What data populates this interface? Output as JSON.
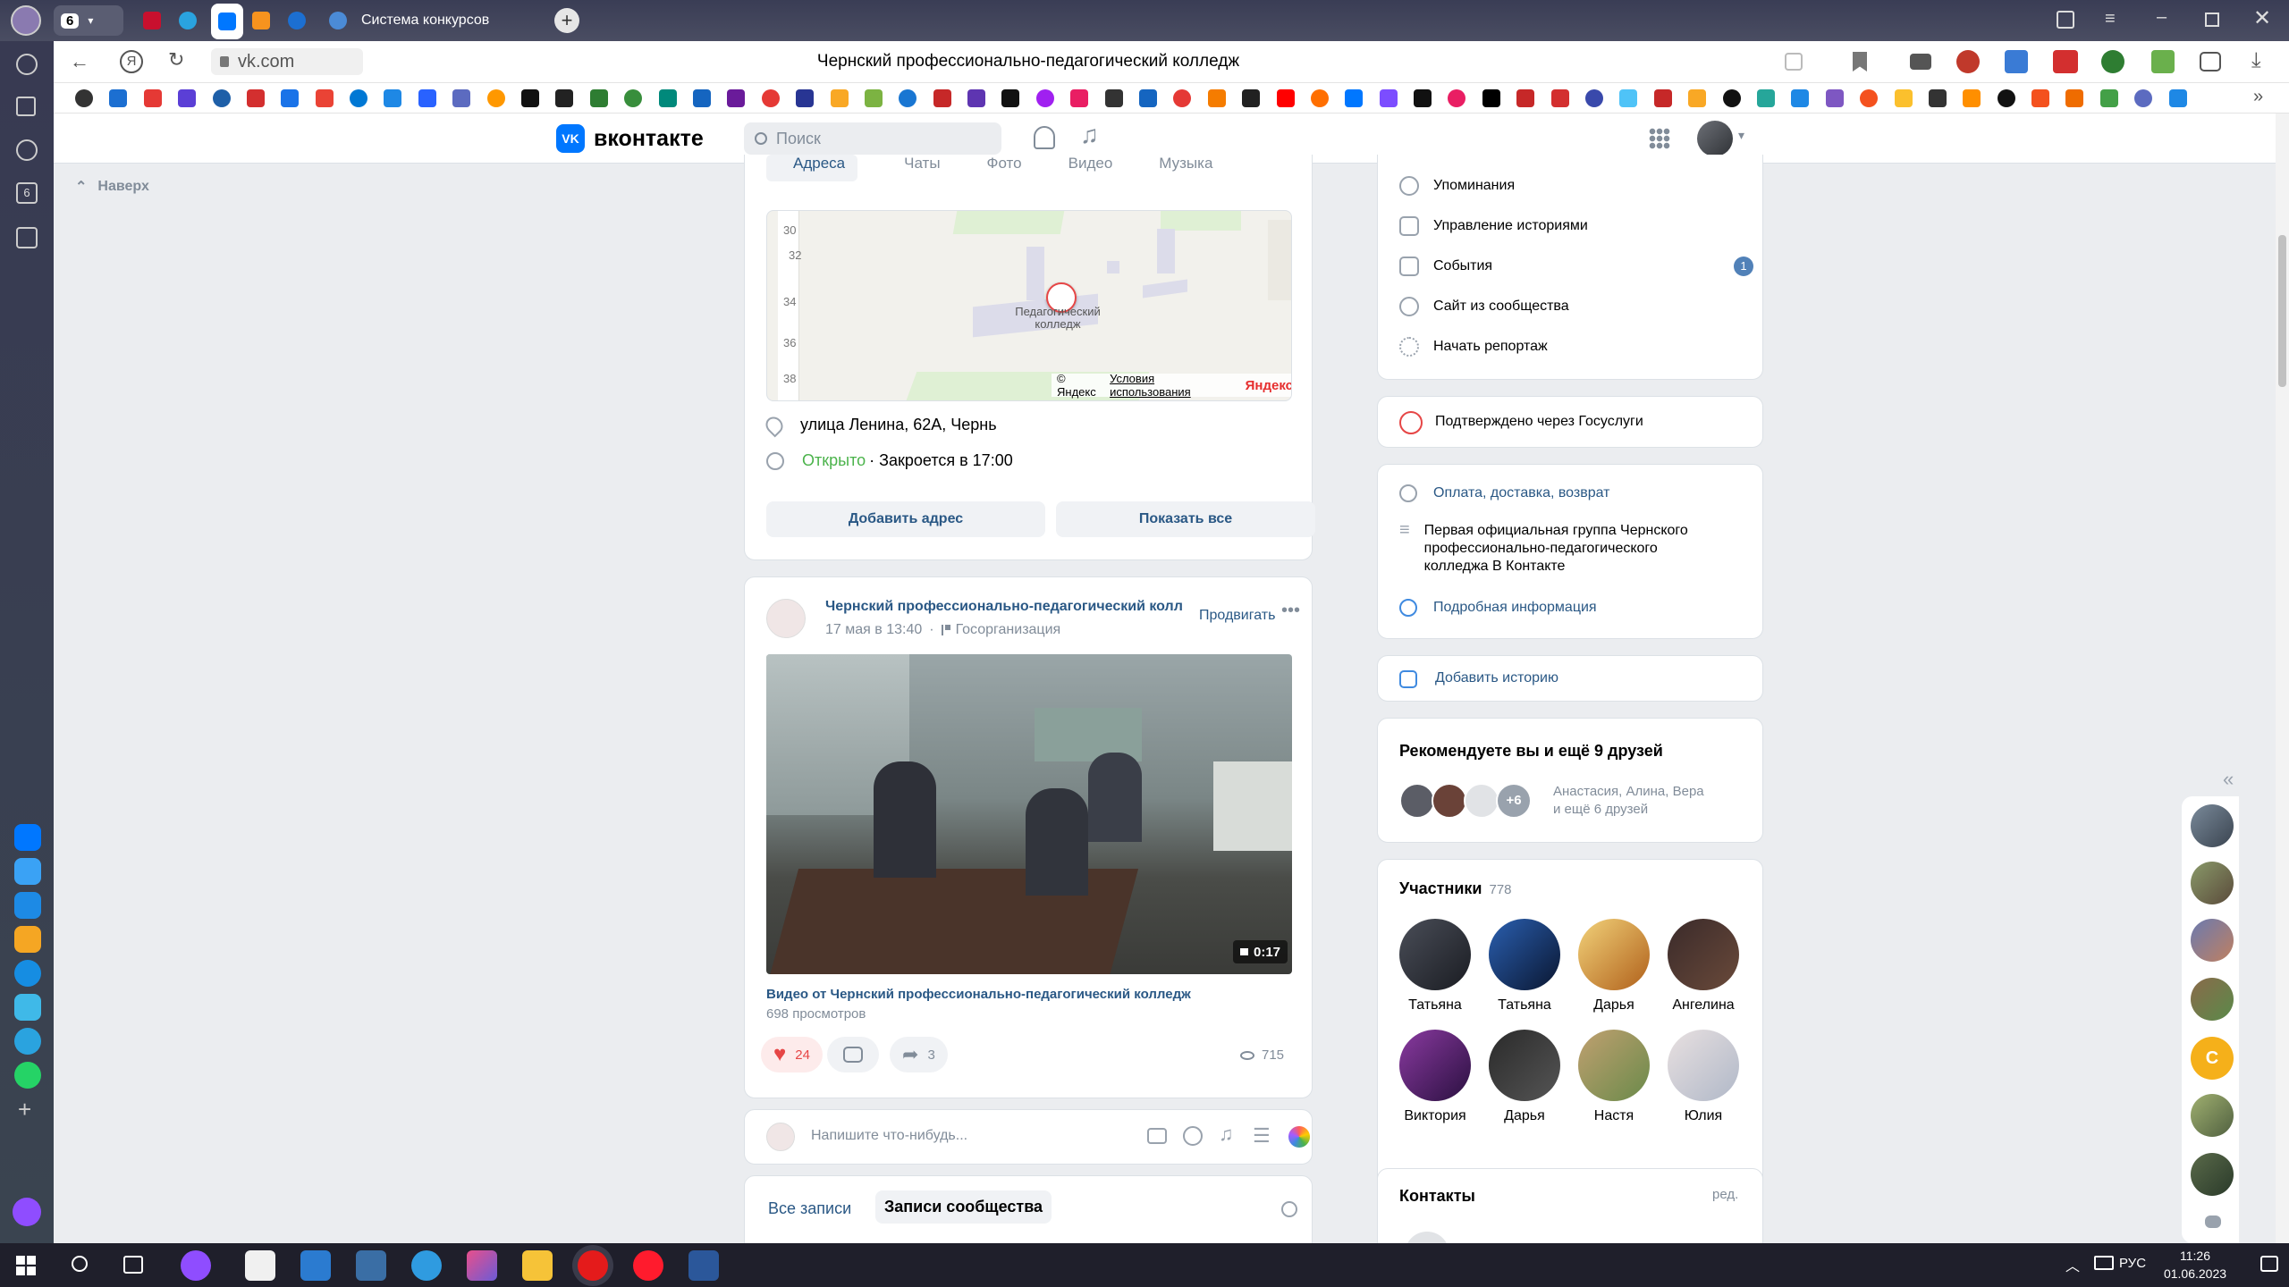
{
  "browser": {
    "tab_count": "6",
    "active_tab_label": "Система конкурсов",
    "url": "vk.com",
    "page_title": "Чернский профессионально-педагогический колледж",
    "yandex_glyph": "Я"
  },
  "vk": {
    "logo_text": "вконтакте",
    "search_placeholder": "Поиск",
    "up_label": "Наверх",
    "nav_tabs": [
      "Адреса",
      "Чаты",
      "Фото",
      "Видео",
      "Музыка"
    ],
    "map": {
      "label_line1": "Педагогический",
      "label_line2": "колледж",
      "copyright": "© Яндекс",
      "terms": "Условия использования",
      "brand": "Яндекс",
      "house_numbers": [
        "30",
        "32",
        "34",
        "36",
        "38"
      ]
    },
    "address": "улица Ленина, 62А, Чернь",
    "hours_open": "Открыто",
    "hours_close": "· Закроется в 17:00",
    "add_address_btn": "Добавить адрес",
    "show_all_btn": "Показать все",
    "post": {
      "author": "Чернский профессионально-педагогический колле,",
      "date": "17 мая в 13:40",
      "org_type": "Госорганизация",
      "promote": "Продвигать",
      "video_duration": "0:17",
      "video_title": "Видео от Чернский профессионально-педагогический колледж",
      "views_text": "698 просмотров",
      "likes": "24",
      "shares": "3",
      "views_count": "715"
    },
    "composer_placeholder": "Напишите что-нибудь...",
    "wall_tabs": [
      "Все записи",
      "Записи сообщества"
    ]
  },
  "sidebar": {
    "menu": [
      {
        "label": "Упоминания"
      },
      {
        "label": "Управление историями"
      },
      {
        "label": "События",
        "badge": "1"
      },
      {
        "label": "Сайт из сообщества"
      },
      {
        "label": "Начать репортаж"
      }
    ],
    "gosuslugi": "Подтверждено через Госуслуги",
    "payment_link": "Оплата, доставка, возврат",
    "description": "Первая официальная группа Чернского профессионально-педагогического колледжа В Контакте",
    "more_info": "Подробная информация",
    "add_story": "Добавить историю",
    "recommend_title": "Рекомендуете вы и ещё 9 друзей",
    "recommend_plus": "+6",
    "recommend_names": "Анастасия, Алина, Вера",
    "recommend_more": "и ещё 6 друзей",
    "members_title": "Участники",
    "members_count": "778",
    "members": [
      "Татьяна",
      "Татьяна",
      "Дарья",
      "Ангелина",
      "Виктория",
      "Дарья",
      "Настя",
      "Юлия"
    ],
    "contacts_title": "Контакты",
    "contacts_edit": "ред."
  },
  "chat_rail": {
    "avatar_letter": "С"
  },
  "taskbar": {
    "lang": "РУС",
    "time": "11:26",
    "date": "01.06.2023"
  },
  "colors": {
    "vk_blue": "#0077ff",
    "link": "#2a5885",
    "open_green": "#4bb34b",
    "like_red": "#e64646"
  }
}
